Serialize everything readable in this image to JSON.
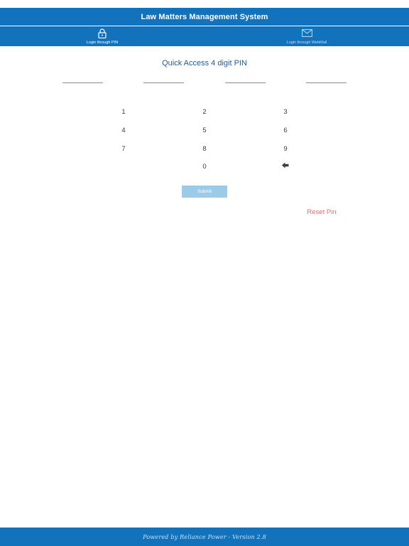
{
  "app": {
    "title": "Law Matters Management System"
  },
  "tabs": [
    {
      "label": "Login through PIN",
      "icon": "lock-icon",
      "active": true
    },
    {
      "label": "Login through WebMail",
      "icon": "mail-icon",
      "active": false
    }
  ],
  "pin": {
    "title": "Quick Access 4 digit PIN",
    "slots": 4
  },
  "keypad": {
    "keys": [
      "1",
      "2",
      "3",
      "4",
      "5",
      "6",
      "7",
      "8",
      "9",
      "0"
    ],
    "backspace_icon": "backspace-arrow-icon"
  },
  "actions": {
    "submit_label": "Submit",
    "reset_label": "Reset Pin"
  },
  "footer": {
    "text": "Powered by Reliance Power - Version 2.8"
  },
  "colors": {
    "primary": "#1272bc",
    "title_blue": "#1a5e97",
    "submit_disabled": "#9ccbea",
    "reset_red": "#e46a6a"
  }
}
